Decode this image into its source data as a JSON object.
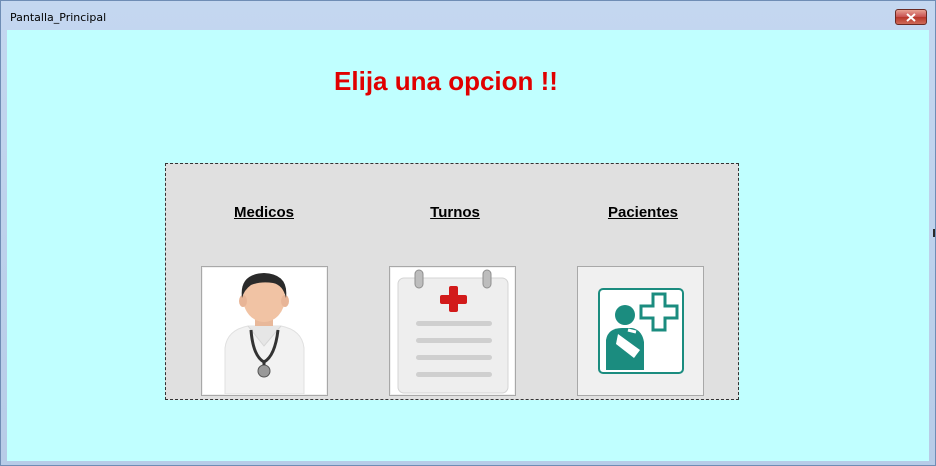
{
  "window": {
    "title": "Pantalla_Principal"
  },
  "heading": "Elija una opcion !!",
  "options": [
    {
      "label": "Medicos",
      "icon": "doctor-icon"
    },
    {
      "label": "Turnos",
      "icon": "medical-calendar-icon"
    },
    {
      "label": "Pacientes",
      "icon": "patient-icon"
    }
  ],
  "colors": {
    "client_background": "#c0ffff",
    "heading": "#e00000",
    "panel": "#e0e0e0"
  }
}
